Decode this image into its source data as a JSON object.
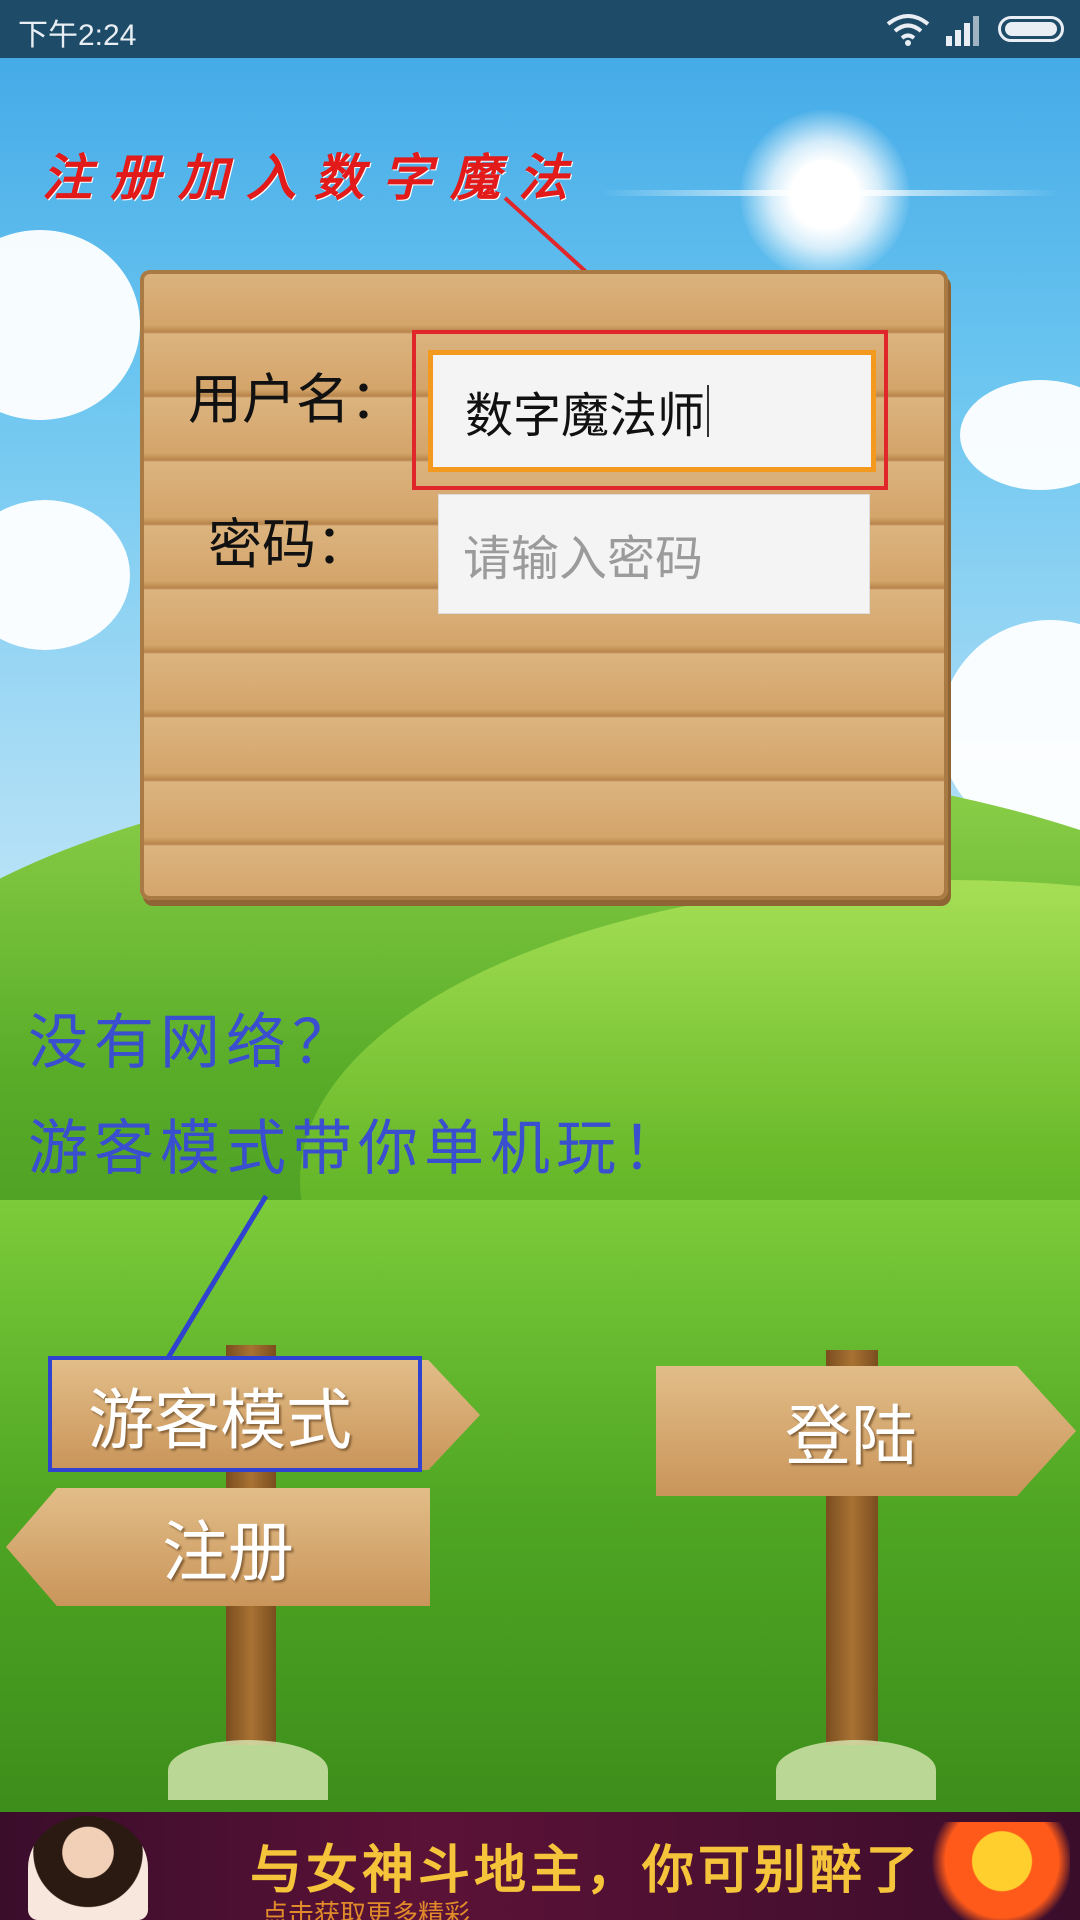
{
  "status_bar": {
    "time": "下午2:24",
    "icons": [
      "wifi-icon",
      "signal-icon",
      "battery-icon"
    ]
  },
  "header": {
    "title": "注册加入数字魔法"
  },
  "form": {
    "username_label": "用户名：",
    "username_value": "数字魔法师",
    "password_label": "密码：",
    "password_placeholder": "请输入密码"
  },
  "promo": {
    "line1": "没有网络？",
    "line2": "游客模式带你单机玩！"
  },
  "buttons": {
    "guest": "游客模式",
    "register": "注册",
    "login": "登陆"
  },
  "ad": {
    "text": "与女神斗地主，你可别醉了",
    "subtext": "点击获取更多精彩"
  },
  "colors": {
    "title_red": "#e21a1a",
    "promo_blue": "#3a4fd0",
    "focus_orange": "#f39a1e",
    "highlight_red": "#e0262b",
    "highlight_blue": "#3042d0"
  }
}
